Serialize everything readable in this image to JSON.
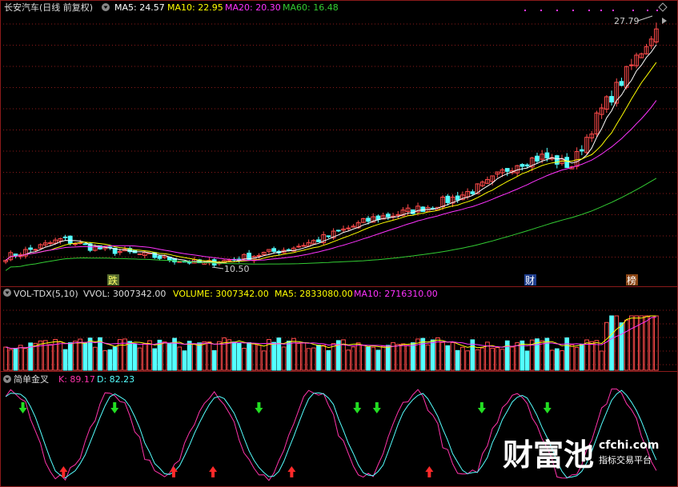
{
  "header": {
    "title": "长安汽车(日线 前复权)",
    "ma5": "MA5: 24.57",
    "ma10": "MA10: 22.95",
    "ma20": "MA20: 20.30",
    "ma60": "MA60: 16.48"
  },
  "annotations": {
    "price_high": "27.79",
    "price_low": "10.50",
    "marker_die": "跌",
    "marker_cai": "财",
    "marker_bang": "榜"
  },
  "volume_header": {
    "title": "VOL-TDX(5,10)",
    "vvol": "VVOL: 3007342.00",
    "volume": "VOLUME: 3007342.00",
    "ma5": "MA5: 2833080.00",
    "ma10": "MA10: 2716310.00"
  },
  "kd_header": {
    "title": "简单金叉",
    "k": "K: 89.17",
    "d": "D: 82.23"
  },
  "watermark": {
    "brand": "财富池",
    "site": "cfchi.com",
    "tagline": "指标交易平台"
  },
  "colors": {
    "up": "#ff4a4a",
    "down": "#54ffff",
    "ma5": "#ffffff",
    "ma10": "#ffff00",
    "ma20": "#ff33ff",
    "ma60": "#33cc33",
    "k": "#ff33aa",
    "d": "#54ffff",
    "grid": "#8b1a1a"
  },
  "chart_data": {
    "type": "candlestick",
    "price_range": [
      10.5,
      27.79
    ],
    "price_series_12day": [
      11.0,
      11.6,
      12.3,
      11.7,
      11.4,
      11.1,
      10.8,
      10.5,
      10.8,
      11.2,
      11.6,
      12.2,
      13.0,
      13.8,
      14.2,
      14.7,
      15.4,
      16.3,
      17.8,
      18.3,
      17.6,
      21.5,
      24.5,
      27.79
    ],
    "ma_latest": {
      "MA5": 24.57,
      "MA10": 22.95,
      "MA20": 20.3,
      "MA60": 16.48
    },
    "volume_latest": {
      "VOLUME": 3007342.0,
      "MA5": 2833080.0,
      "MA10": 2716310.0
    },
    "kd_latest": {
      "K": 89.17,
      "D": 82.23
    },
    "kd_signal_arrows_up_pct": [
      0.092,
      0.26,
      0.32,
      0.44,
      0.65
    ],
    "kd_signal_arrows_down_pct": [
      0.03,
      0.17,
      0.39,
      0.54,
      0.57,
      0.73,
      0.83
    ]
  }
}
